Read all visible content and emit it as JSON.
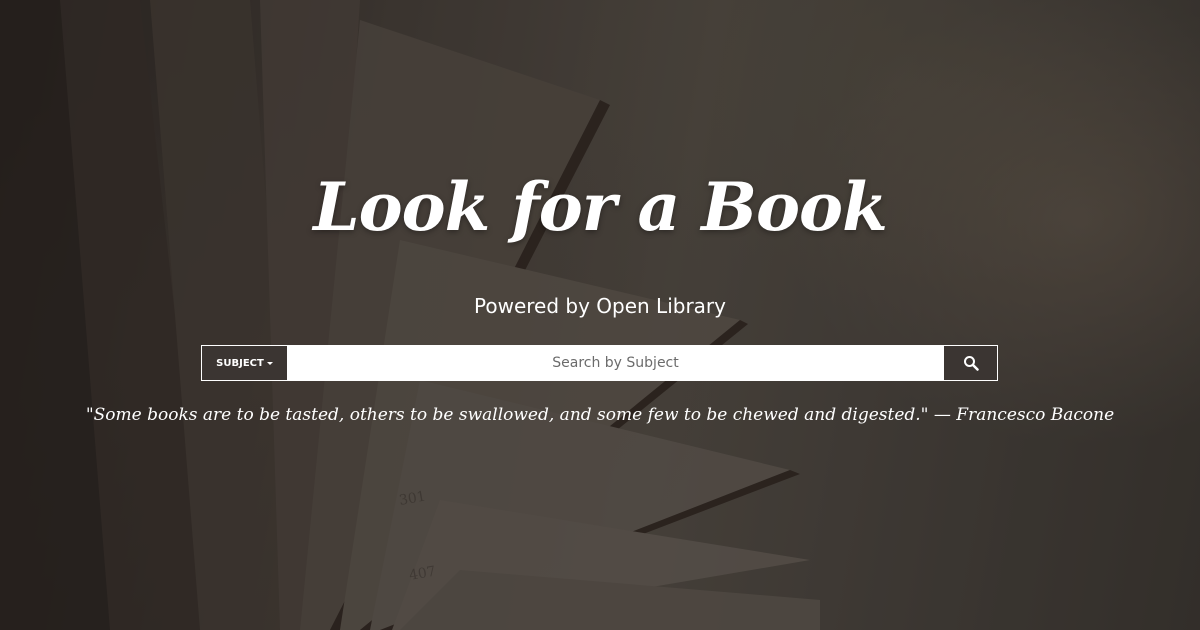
{
  "hero": {
    "title": "Look for a Book",
    "subtitle": "Powered by Open Library"
  },
  "search": {
    "dropdown_label": "SUBJECT",
    "placeholder": "Search by Subject",
    "value": "",
    "button_icon": "search-icon"
  },
  "quote": {
    "text": "\"Some books are to be tasted, others to be swallowed, and some few to be chewed and digested.\" — Francesco Bacone"
  },
  "colors": {
    "overlay": "#1e1a18",
    "control_bg": "#3b3532",
    "text": "#ffffff"
  },
  "background": {
    "book_page_numbers": [
      "301",
      "407"
    ]
  }
}
